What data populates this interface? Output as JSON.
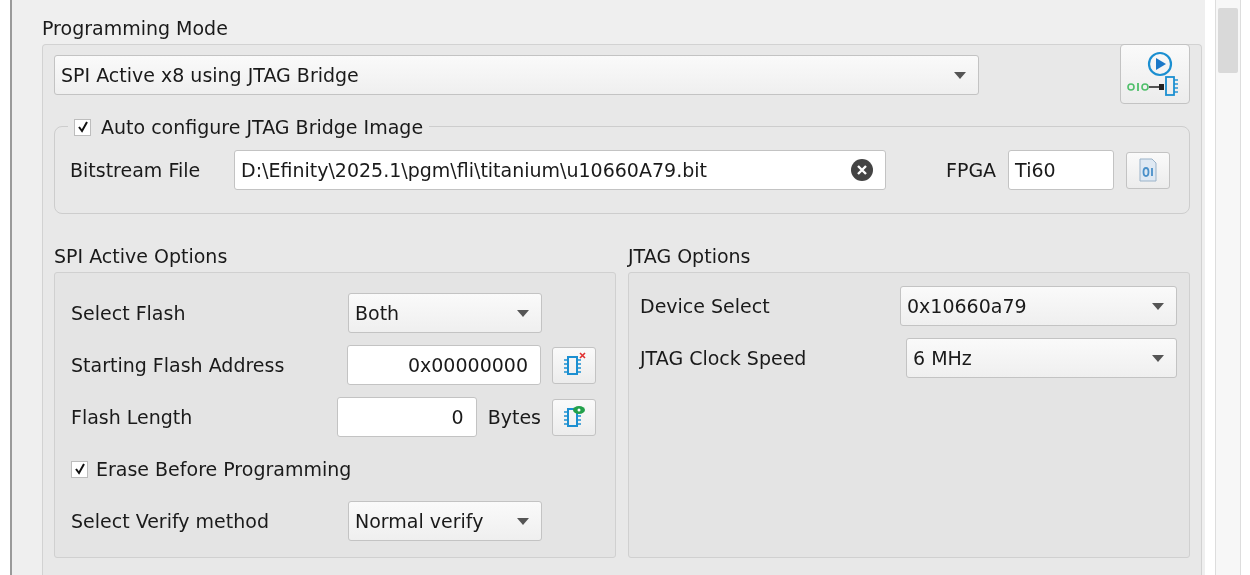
{
  "programming_mode": {
    "title": "Programming Mode",
    "mode": "SPI Active x8 using JTAG Bridge"
  },
  "auto_configure": {
    "label": "Auto configure JTAG Bridge Image",
    "checked": true,
    "bitstream_label": "Bitstream File",
    "bitstream_value": "D:\\Efinity\\2025.1\\pgm\\fli\\titanium\\u10660A79.bit",
    "fpga_label": "FPGA",
    "fpga_value": "Ti60"
  },
  "spi_options": {
    "title": "SPI Active Options",
    "rows": [
      {
        "kind": "select",
        "label": "Select Flash",
        "value": "Both"
      },
      {
        "kind": "address",
        "label": "Starting Flash Address",
        "value": "0x00000000"
      },
      {
        "kind": "length",
        "label": "Flash Length",
        "value": "0",
        "unit": "Bytes"
      },
      {
        "kind": "checkbox",
        "label": "Erase Before Programming",
        "checked": true
      },
      {
        "kind": "select",
        "label": "Select Verify method",
        "value": "Normal verify"
      }
    ]
  },
  "jtag_options": {
    "title": "JTAG Options",
    "rows": [
      {
        "kind": "select",
        "label": "Device Select",
        "value": "0x10660a79"
      },
      {
        "kind": "select",
        "label": "JTAG Clock Speed",
        "value": "6 MHz"
      }
    ]
  }
}
